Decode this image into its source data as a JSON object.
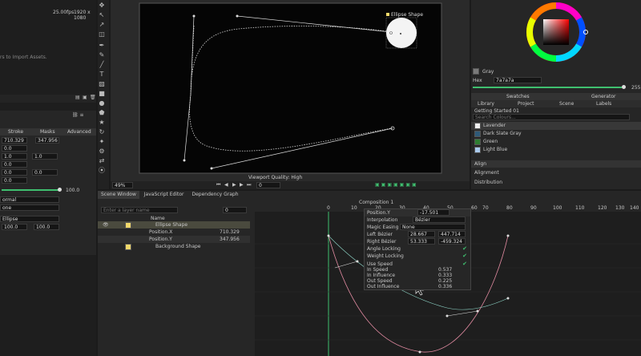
{
  "left_panel": {
    "fps": "25.00fps",
    "resolution": "1920 x 1080",
    "import_hint": "rs to Import Assets.",
    "table_headers": [
      "Stroke",
      "Masks",
      "Advanced"
    ],
    "values": {
      "x1": "710.329",
      "x2": "347.956",
      "zero1": "0.0",
      "one_a": "1.0",
      "one_b": "1.0",
      "zero2": "0.0",
      "zero3": "0.0",
      "zero4": "0.0",
      "zero5": "0.0",
      "hundred": "100.0"
    },
    "blend_mode": "ormal",
    "mode2": "one",
    "ellipse_label": "Ellipse",
    "scale_a": "100.0",
    "scale_b": "100.0"
  },
  "viewport": {
    "shape_label": "Ellipse Shape",
    "quality": "Viewport Quality: High",
    "zoom": "49%",
    "frame": "0"
  },
  "timeline": {
    "tabs": [
      "Scene Window",
      "JavaScript Editor",
      "Dependency Graph"
    ],
    "composition": "Composition 1",
    "search_placeholder": "Enter a layer name",
    "frame_input": "0",
    "name_header": "Name",
    "layers": [
      {
        "name": "Ellipse Shape",
        "color": "#f2d96b"
      },
      {
        "name": "Position.X",
        "value": "710.329"
      },
      {
        "name": "Position.Y",
        "value": "347.956"
      },
      {
        "name": "Background Shape",
        "color": "#f2d96b"
      }
    ],
    "ruler_ticks": [
      "0",
      "10",
      "20",
      "30",
      "40",
      "50",
      "60",
      "70",
      "80",
      "90",
      "100",
      "110",
      "120",
      "130",
      "140"
    ]
  },
  "context_menu": {
    "title": "Position.Y",
    "title_value": "-17.501",
    "interpolation_label": "Interpolation",
    "interpolation_value": "Bézier",
    "magic_easing_label": "Magic Easing",
    "magic_easing_value": "None",
    "left_bezier_label": "Left Bézier",
    "left_bezier_a": "28.667",
    "left_bezier_b": "447.714",
    "right_bezier_label": "Right Bézier",
    "right_bezier_a": "53.333",
    "right_bezier_b": "-459.324",
    "angle_locking": "Angle Locking",
    "weight_locking": "Weight Locking",
    "use_speed": "Use Speed",
    "in_speed_label": "In Speed",
    "in_speed": "0.537",
    "in_influence_label": "In Influence",
    "in_influence": "0.333",
    "out_speed_label": "Out Speed",
    "out_speed": "0.225",
    "out_influence_label": "Out Influence",
    "out_influence": "0.336"
  },
  "right_panel": {
    "color_name": "Gray",
    "hex_label": "Hex",
    "hex_value": "7a7a7a",
    "slider_value": "255",
    "tabs": [
      "Swatches",
      "Generator"
    ],
    "subtabs": [
      "Library",
      "Project",
      "Scene",
      "Labels"
    ],
    "group": "Getting Started 01",
    "search_placeholder": "Search Colours...",
    "swatches": [
      {
        "name": "Lavender",
        "color": "#f0f0f0"
      },
      {
        "name": "Dark Slate Gray",
        "color": "#2f5a78"
      },
      {
        "name": "Green",
        "color": "#2e7d32"
      },
      {
        "name": "Light Blue",
        "color": "#a9c9ec"
      }
    ],
    "align_tab": "Align",
    "alignment": "Alignment",
    "distribution": "Distribution"
  },
  "colors": {
    "accent_green": "#3fbf6f",
    "curve_pink": "#e08aa0",
    "curve_cyan": "#8fd6c8"
  }
}
